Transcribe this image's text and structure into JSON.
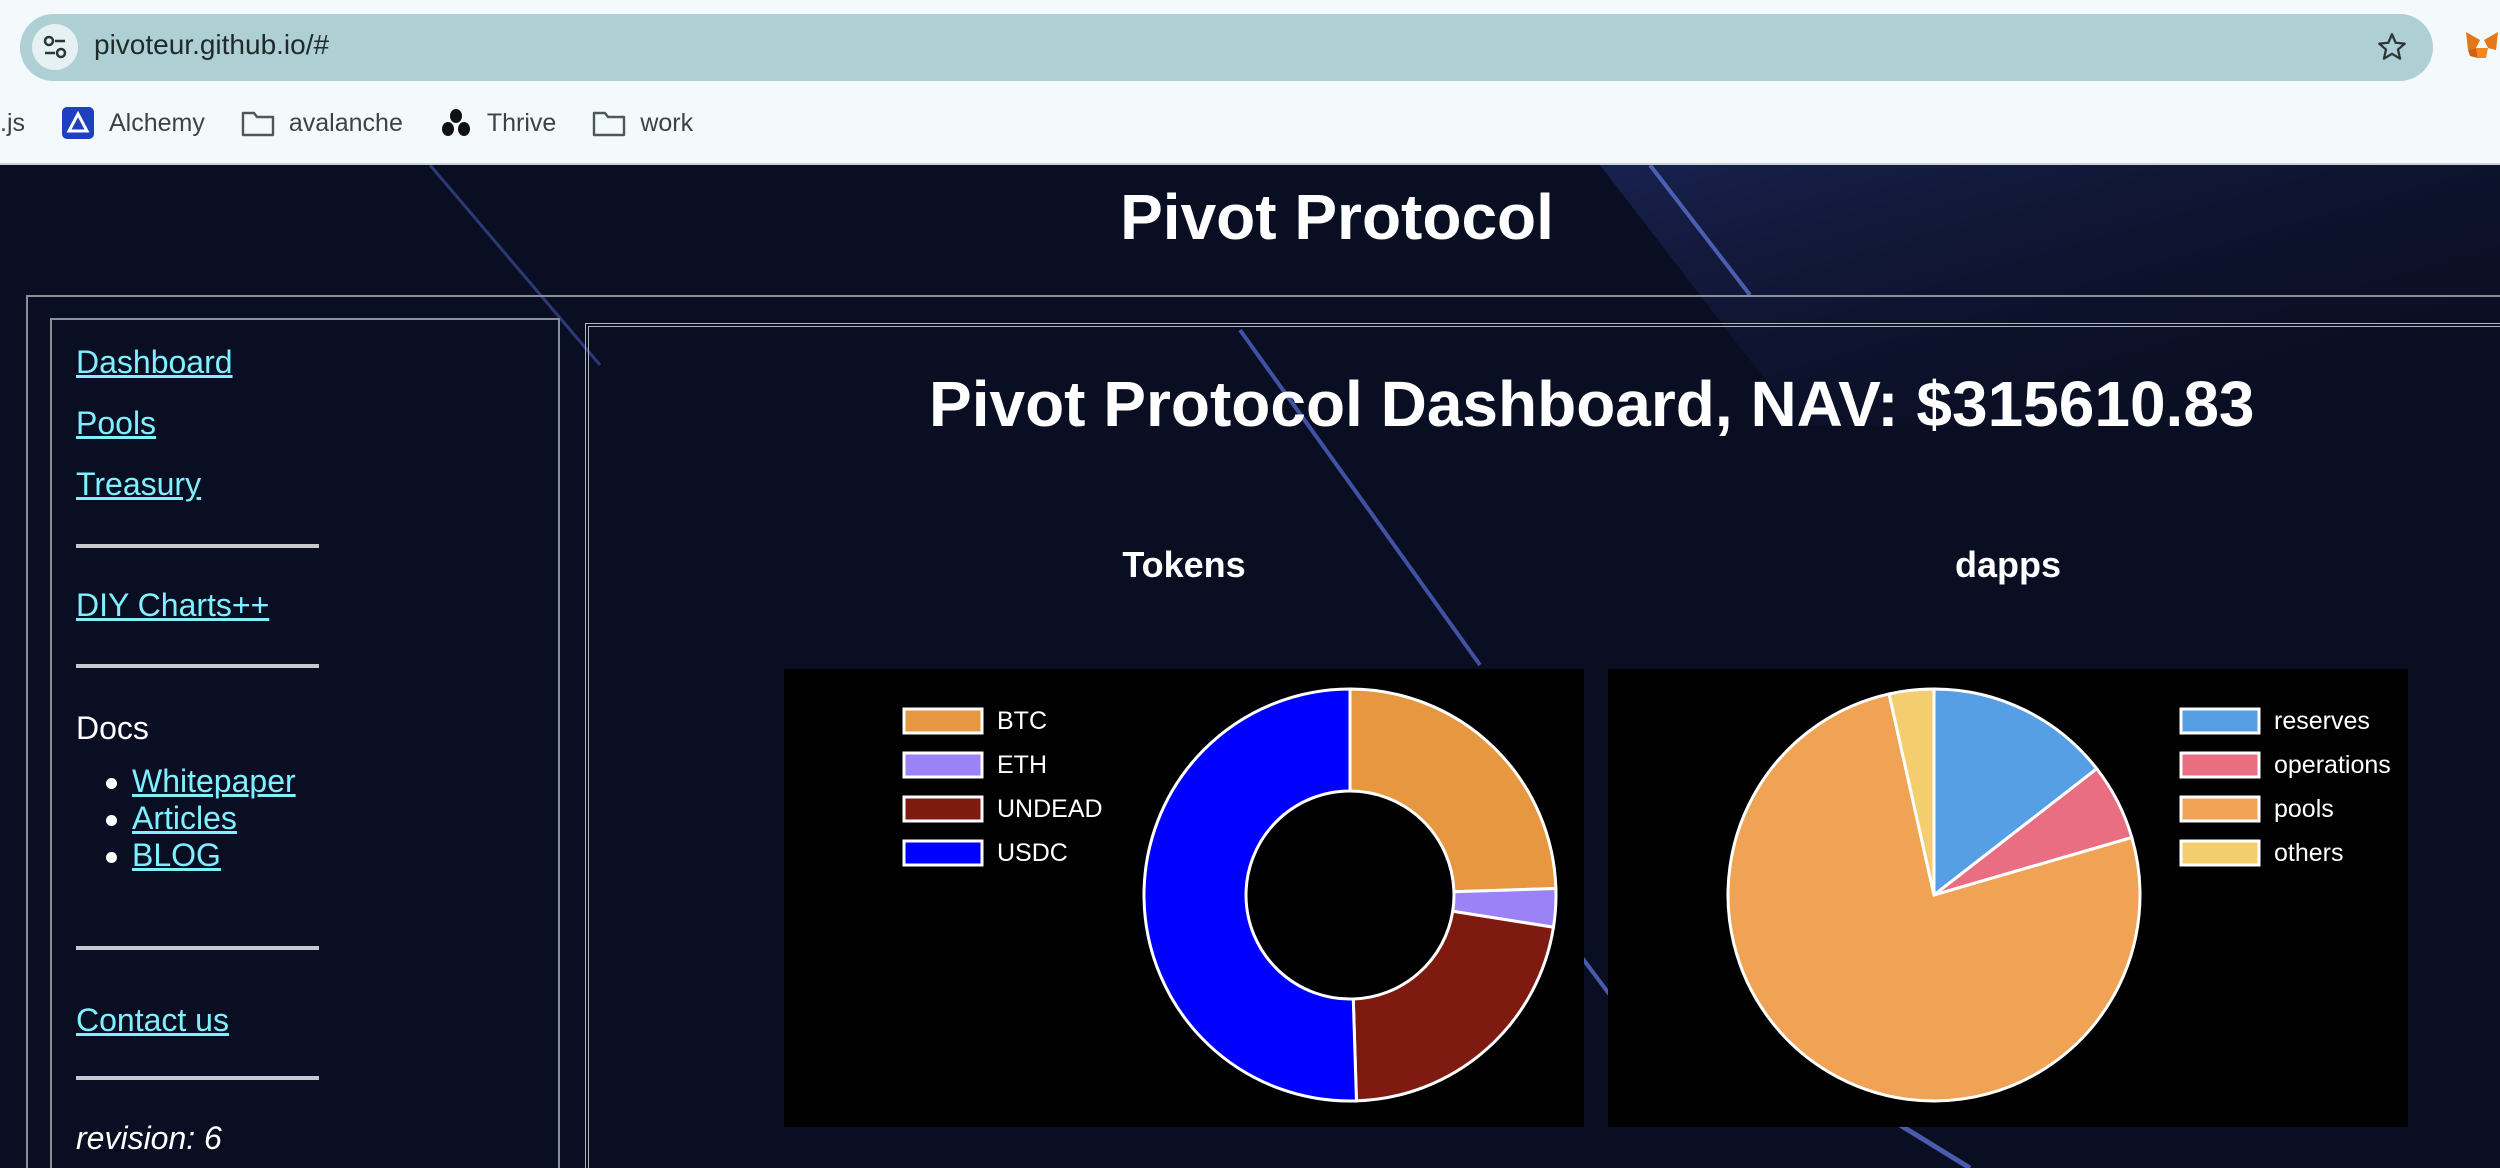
{
  "browser": {
    "url": "pivoteur.github.io/#",
    "bookmarks": [
      {
        "label": ".js",
        "icon": "none"
      },
      {
        "label": "Alchemy",
        "icon": "alchemy-icon"
      },
      {
        "label": "avalanche",
        "icon": "folder-icon"
      },
      {
        "label": "Thrive",
        "icon": "thrive-icon"
      },
      {
        "label": "work",
        "icon": "folder-icon"
      }
    ]
  },
  "page": {
    "title": "Pivot Protocol",
    "dashboard_title": "Pivot Protocol Dashboard, NAV: $315610.83"
  },
  "sidebar": {
    "links": [
      "Dashboard",
      "Pools",
      "Treasury"
    ],
    "diy": "DIY Charts++",
    "docs_label": "Docs",
    "docs": [
      "Whitepaper",
      "Articles",
      "BLOG"
    ],
    "contact": "Contact us",
    "revision": "revision: 6"
  },
  "colors": {
    "link": "#7ff0ff",
    "background": "#0a0e22"
  },
  "chart_data": [
    {
      "type": "pie",
      "variant": "doughnut",
      "title": "Tokens",
      "legend_position": "top-left",
      "categories": [
        "BTC",
        "ETH",
        "UNDEAD",
        "USDC"
      ],
      "values": [
        24.5,
        3.0,
        22.0,
        50.5
      ],
      "colors": [
        "#e6973f",
        "#9b82f7",
        "#7f1a11",
        "#0000ff"
      ]
    },
    {
      "type": "pie",
      "title": "dapps",
      "legend_position": "top-right",
      "categories": [
        "reserves",
        "operations",
        "pools",
        "others"
      ],
      "values": [
        14.5,
        6.0,
        76.0,
        3.5
      ],
      "colors": [
        "#579fe4",
        "#ea6e82",
        "#f0a255",
        "#f4cd6e"
      ]
    }
  ]
}
